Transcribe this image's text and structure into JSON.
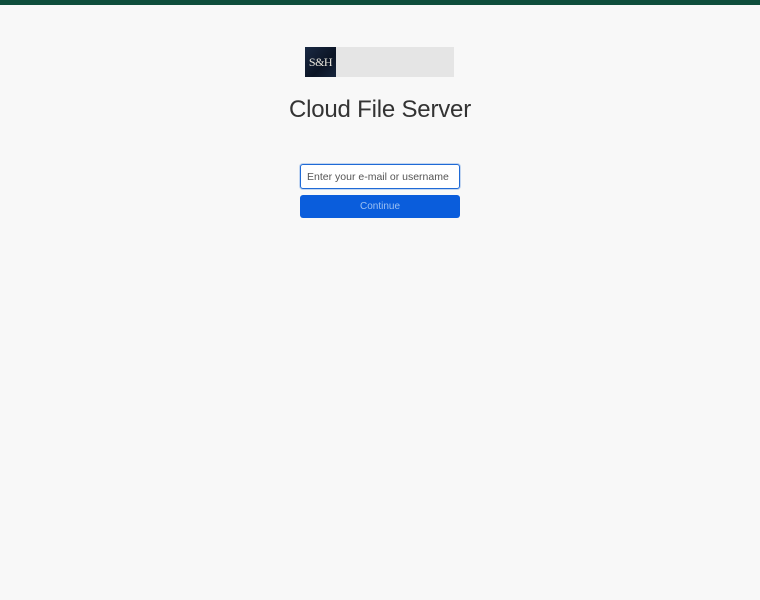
{
  "brand": {
    "logo_text": "S&H",
    "top_bar_color": "#0e4e3c"
  },
  "page": {
    "title": "Cloud File Server"
  },
  "login": {
    "input_value": "",
    "input_placeholder": "Enter your e-mail or username",
    "continue_label": "Continue",
    "accent_color": "#0a5ddc"
  }
}
